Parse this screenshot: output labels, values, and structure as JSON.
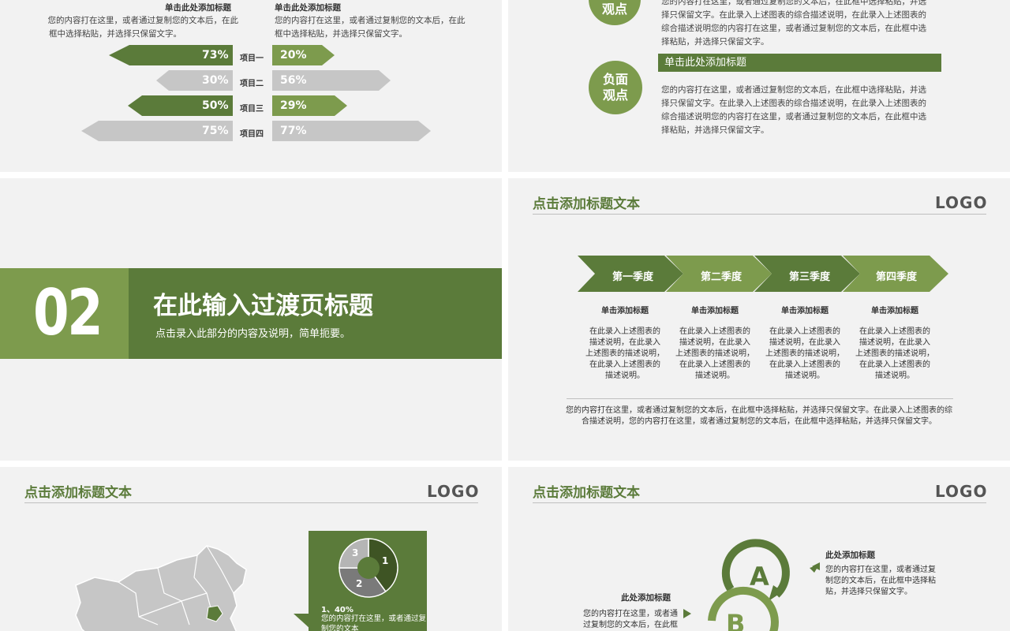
{
  "slide1": {
    "left_heading": "单击此处添加标题",
    "left_text": [
      "您的内容打在这里，或者通过复制您的文本后，在此",
      "框中选择粘贴，并选择只保留文字。"
    ],
    "right_heading": "单击此处添加标题",
    "right_text": [
      "您的内容打在这里，或者通过复制您的文本后，在此",
      "框中选择粘贴，并选择只保留文字。"
    ],
    "rows": [
      {
        "item": "项目一",
        "left": "73%",
        "right": "20%",
        "left_pct": 73,
        "right_pct": 20
      },
      {
        "item": "项目二",
        "left": "30%",
        "right": "56%",
        "left_pct": 30,
        "right_pct": 56
      },
      {
        "item": "项目三",
        "left": "50%",
        "right": "29%",
        "left_pct": 50,
        "right_pct": 29
      },
      {
        "item": "项目四",
        "left": "75%",
        "right": "77%",
        "left_pct": 75,
        "right_pct": 77
      }
    ]
  },
  "slide2": {
    "badge_top": "观点",
    "top_text": [
      "您的内容打在这里，或者通过复制您的文本后，在此框中选择粘贴，并选",
      "择只保留文字。在此录入上述图表的综合描述说明，在此录入上述图表的",
      "综合描述说明您的内容打在这里，或者通过复制您的文本后，在此框中选",
      "择粘贴，并选择只保留文字。"
    ],
    "badge_neg_1": "负面",
    "badge_neg_2": "观点",
    "bar_heading": "单击此处添加标题",
    "neg_text": [
      "您的内容打在这里，或者通过复制您的文本后，在此框中选择粘贴，并选",
      "择只保留文字。在此录入上述图表的综合描述说明，在此录入上述图表的",
      "综合描述说明您的内容打在这里，或者通过复制您的文本后，在此框中选",
      "择粘贴，并选择只保留文字。"
    ]
  },
  "slide3": {
    "number": "02",
    "title": "在此输入过渡页标题",
    "subtitle": "点击录入此部分的内容及说明，简单扼要。"
  },
  "slide4": {
    "title": "点击添加标题文本",
    "logo": "LOGO",
    "quarters": [
      "第一季度",
      "第二季度",
      "第三季度",
      "第四季度"
    ],
    "col_heading": "单击添加标题",
    "col_text": [
      "在此录入上述图表的",
      "描述说明，在此录入",
      "上述图表的描述说明，",
      "在此录入上述图表的",
      "描述说明。"
    ],
    "bottom_text": [
      "您的内容打在这里，或者通过复制您的文本后，在此框中选择粘贴，并选择只保留文字。在此录入上述图表的综",
      "合描述说明，您的内容打在这里，或者通过复制您的文本后，在此框中选择粘贴，并选择只保留文字。"
    ]
  },
  "slide5": {
    "title": "点击添加标题文本",
    "logo": "LOGO",
    "pie_labels": [
      "1",
      "2",
      "3"
    ],
    "pie_values": [
      40,
      35,
      25
    ],
    "item_head": "1、40%",
    "item_text": [
      "您的内容打在这里，或者通过复",
      "制您的文本"
    ]
  },
  "slide6": {
    "title": "点击添加标题文本",
    "logo": "LOGO",
    "right_heading": "此处添加标题",
    "right_text": [
      "您的内容打在这里，或者通过复",
      "制您的文本后，在此框中选择粘",
      "贴，并选择只保留文字。"
    ],
    "left_heading": "此处添加标题",
    "left_text": [
      "您的内容打在这里，或者通",
      "过复制您的文本后，在此框"
    ],
    "letter_a": "A",
    "letter_b": "B"
  },
  "colors": {
    "dark_green": "#5b7b3a",
    "light_green": "#7d9b4d",
    "gray_bar": "#c6c6c6",
    "slide_bg": "#f2f2f2"
  }
}
